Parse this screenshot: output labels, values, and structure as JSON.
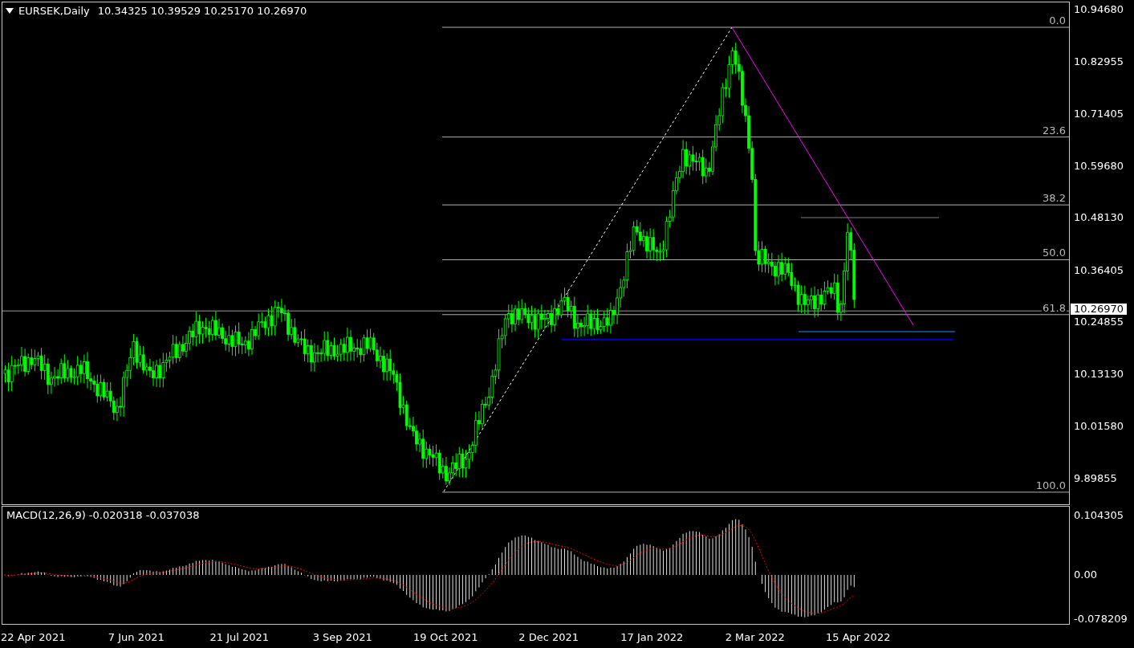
{
  "chart": {
    "symbol_title": "EURSEK,Daily",
    "ohlc": "10.34325 10.39529 10.25170 10.26970",
    "current_price": "10.26970",
    "price_axis": [
      "10.94680",
      "10.82955",
      "10.71405",
      "10.59680",
      "10.48130",
      "10.36405",
      "10.24855",
      "10.13130",
      "10.01580",
      "9.89855"
    ],
    "fib_levels": [
      "0.0",
      "23.6",
      "38.2",
      "50.0",
      "61.8",
      "100.0"
    ]
  },
  "macd": {
    "title": "MACD(12,26,9) -0.020318 -0.037038",
    "axis": [
      "0.104305",
      "0.00",
      "-0.078209"
    ]
  },
  "date_axis": [
    "22 Apr 2021",
    "7 Jun 2021",
    "21 Jul 2021",
    "3 Sep 2021",
    "19 Oct 2021",
    "2 Dec 2021",
    "17 Jan 2022",
    "2 Mar 2022",
    "15 Apr 2022"
  ]
}
